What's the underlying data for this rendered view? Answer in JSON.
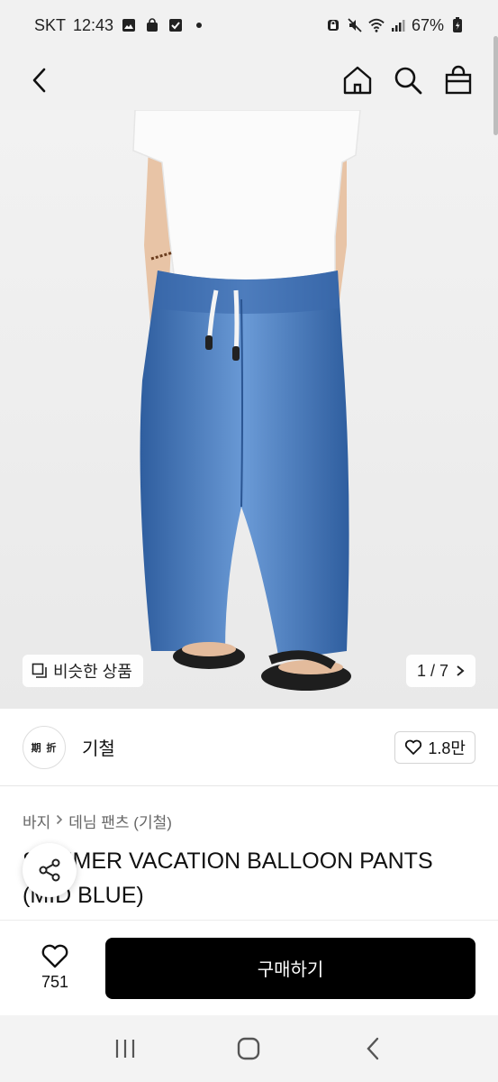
{
  "status_bar": {
    "carrier": "SKT",
    "time": "12:43",
    "battery": "67%",
    "icons": [
      "gallery-icon",
      "bag-icon",
      "check-icon",
      "dot-icon",
      "lock-icon",
      "mute-icon",
      "wifi-icon",
      "signal-icon",
      "battery-icon"
    ]
  },
  "header": {
    "back_icon": "chevron-left-icon",
    "actions": [
      "home-icon",
      "search-icon",
      "shopping-bag-icon"
    ]
  },
  "hero": {
    "similar_label": "비슷한 상품",
    "page_counter": "1 / 7"
  },
  "brand": {
    "logo_text": "期 折",
    "name": "기철",
    "likes": "1.8만"
  },
  "breadcrumb": [
    "바지",
    "데님 팬츠 (기철)"
  ],
  "product": {
    "title": "SUMMER VACATION BALLOON PANTS (MID BLUE)"
  },
  "bottom_bar": {
    "wish_count": "751",
    "buy_label": "구매하기"
  },
  "colors": {
    "accent": "#000000",
    "denim": "#3f74b8",
    "background": "#ffffff"
  }
}
